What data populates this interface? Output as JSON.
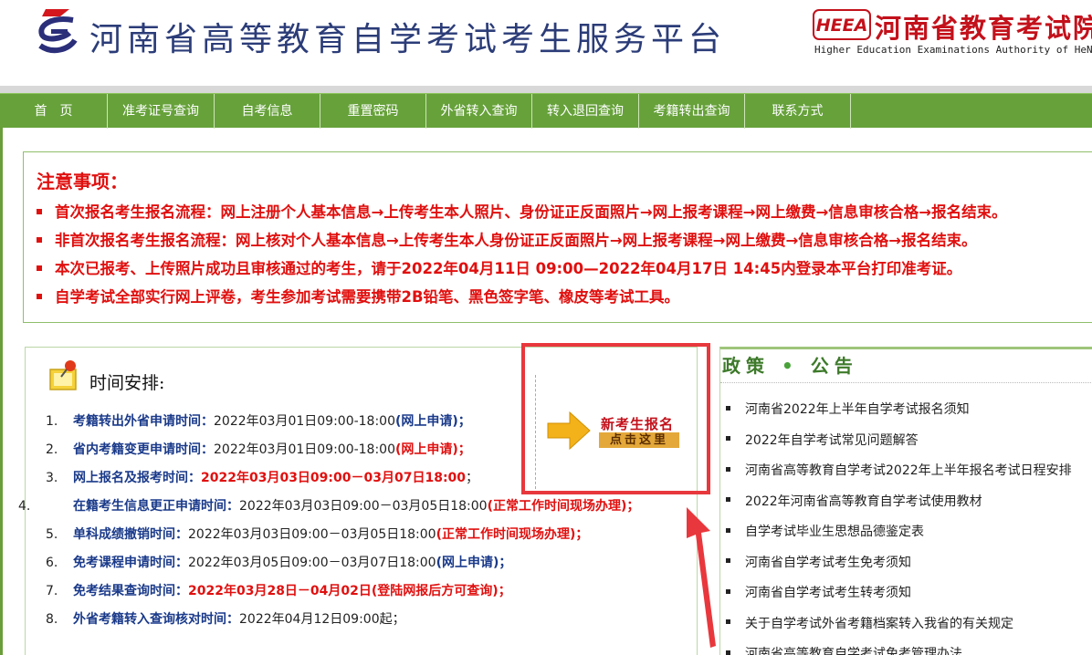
{
  "header": {
    "title": "河南省高等教育自学考试考生服务平台",
    "heea_logo_text": "HEEA",
    "heea_cn": "河南省教育考试院",
    "heea_en": "Higher Education Examinations Authority of HeNan Province"
  },
  "nav": {
    "items": [
      {
        "label": "首　页"
      },
      {
        "label": "准考证号查询"
      },
      {
        "label": "自考信息"
      },
      {
        "label": "重置密码"
      },
      {
        "label": "外省转入查询"
      },
      {
        "label": "转入退回查询"
      },
      {
        "label": "考籍转出查询"
      },
      {
        "label": "联系方式"
      }
    ]
  },
  "notice": {
    "title": "注意事项：",
    "items": [
      "首次报名考生报名流程：网上注册个人基本信息→上传考生本人照片、身份证正反面照片→网上报考课程→网上缴费→信息审核合格→报名结束。",
      "非首次报名考生报名流程：网上核对个人基本信息→上传考生本人身份证正反面照片→网上报考课程→网上缴费→信息审核合格→报名结束。",
      "本次已报考、上传照片成功且审核通过的考生，请于2022年04月11日 09:00—2022年04月17日 14:45内登录本平台打印准考证。",
      "自学考试全部实行网上评卷，考生参加考试需要携带2B铅笔、黑色签字笔、橡皮等考试工具。"
    ]
  },
  "schedule": {
    "title": "时间安排:",
    "items": [
      {
        "num": "1.",
        "label": "考籍转出外省申请时间：",
        "time": "2022年03月01日09:00-18:00",
        "note": "(网上申请)；"
      },
      {
        "num": "2.",
        "label": "省内考籍变更申请时间：",
        "time": "2022年03月01日09:00-18:00",
        "note": "(网上申请)；"
      },
      {
        "num": "3.",
        "label": "网上报名及报考时间：",
        "time": "2022年03月03日09:00－03月07日18:00",
        "note": "；"
      },
      {
        "num": "4.",
        "label": "在籍考生信息更正申请时间：",
        "time": "2022年03月03日09:00－03月05日18:00",
        "note": "(正常工作时间现场办理)；"
      },
      {
        "num": "5.",
        "label": "单科成绩撤销时间：",
        "time": "2022年03月03日09:00－03月05日18:00",
        "note": "(正常工作时间现场办理)；"
      },
      {
        "num": "6.",
        "label": "免考课程申请时间：",
        "time": "2022年03月05日09:00－03月07日18:00",
        "note": "(网上申请)；"
      },
      {
        "num": "7.",
        "label": "免考结果查询时间：",
        "time": "2022年03月28日－04月02日",
        "note": "(登陆网报后方可查询)；"
      },
      {
        "num": "8.",
        "label": "外省考籍转入查询核对时间：",
        "time": "2022年04月12日09:00",
        "note": "起；"
      }
    ]
  },
  "register": {
    "line1": "新考生报名",
    "line2": "点击这里"
  },
  "policy": {
    "title_part1": "政策",
    "title_dot": "•",
    "title_part2": "公告",
    "items": [
      "河南省2022年上半年自学考试报名须知",
      "2022年自学考试常见问题解答",
      "河南省高等教育自学考试2022年上半年报名考试日程安排",
      "2022年河南省高等教育自学考试使用教材",
      "自学考试毕业生思想品德鉴定表",
      "河南省自学考试考生免考须知",
      "河南省自学考试考生转考须知",
      "关于自学考试外省考籍档案转入我省的有关规定",
      "河南省高等教育自学考试免考管理办法"
    ]
  },
  "colors": {
    "nav_green": "#66a13a",
    "notice_red": "#e0100f",
    "title_blue": "#2b3c78",
    "label_blue": "#1a3a8a",
    "annotation_red": "#e8383d"
  }
}
